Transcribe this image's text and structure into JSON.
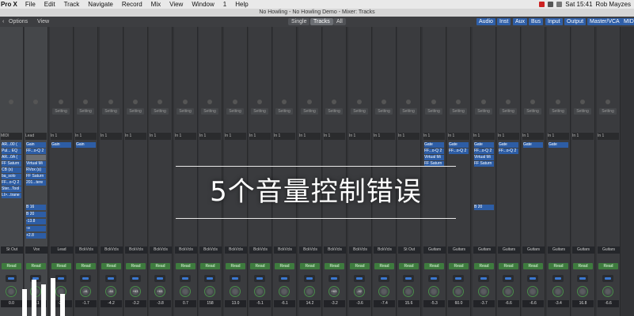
{
  "menubar": {
    "app_name": "Pro X",
    "items": [
      "File",
      "Edit",
      "Track",
      "Navigate",
      "Record",
      "Mix",
      "View",
      "Window",
      "1",
      "Help"
    ],
    "clock": "Sat 15:41",
    "user": "Rob Mayzes"
  },
  "window": {
    "title": "No Howling - No Howling Demo - Mixer: Tracks"
  },
  "toolbar": {
    "options_label": "Options",
    "view_label": "View",
    "view_modes": [
      "Single",
      "Tracks",
      "All"
    ],
    "active_view_mode": "Tracks",
    "filters": [
      "Audio",
      "Inst",
      "Aux",
      "Bus",
      "Input",
      "Output",
      "Master/VCA",
      "MIDI"
    ]
  },
  "overlay": {
    "caption": "5个音量控制错误"
  },
  "colors": {
    "accent_blue": "#2d5da5",
    "read_green": "#3e7b3e",
    "window_bg": "#2b2c2e",
    "strip_bg": "#3a3b3e"
  },
  "strips": [
    {
      "name": "St Out",
      "io": "MIDI",
      "setting": "",
      "plugins": [
        "AR...00 (",
        "Pul... EQ",
        "AR...0A (",
        "FF Saturn",
        "CB (s)",
        "ba_solo",
        "FF...o-Q 2",
        "Ster...Tool",
        "LI>...trane"
      ],
      "sends": [],
      "auto": "Read",
      "volume": "0.0",
      "knob": "",
      "sel": true
    },
    {
      "name": "Vox",
      "io": "Lead",
      "setting": "",
      "plugins": [
        "Gain",
        "FF...o-Q 2",
        "",
        "Virtual Mi",
        "RVox (s)",
        "FF Saturn",
        "201...tere"
      ],
      "sends": [
        "B 16",
        "B 20",
        "-13.8",
        "-∞",
        "+2.8"
      ],
      "auto": "Read",
      "volume": "-4.1",
      "knob": "",
      "sel": true
    },
    {
      "name": "Lead",
      "io": "In 1",
      "setting": "Setting",
      "plugins": [
        "Gain"
      ],
      "sends": [],
      "auto": "Read",
      "volume": "-2.9",
      "knob": "",
      "sel": false
    },
    {
      "name": "BckVcls",
      "io": "In 1",
      "setting": "Setting",
      "plugins": [
        "Gain"
      ],
      "sends": [],
      "auto": "Read",
      "volume": "-1.7",
      "knob": "-41",
      "sel": false
    },
    {
      "name": "BckVcls",
      "io": "In 1",
      "setting": "Setting",
      "plugins": [],
      "sends": [],
      "auto": "Read",
      "volume": "-4.2",
      "knob": "-64",
      "sel": false
    },
    {
      "name": "BckVcls",
      "io": "In 1",
      "setting": "Setting",
      "plugins": [],
      "sends": [],
      "auto": "Read",
      "volume": "-3.2",
      "knob": "+63",
      "sel": false
    },
    {
      "name": "BckVcls",
      "io": "In 1",
      "setting": "Setting",
      "plugins": [],
      "sends": [],
      "auto": "Read",
      "volume": "-3.8",
      "knob": "+63",
      "sel": false
    },
    {
      "name": "BckVcls",
      "io": "In 1",
      "setting": "Setting",
      "plugins": [],
      "sends": [],
      "auto": "Read",
      "volume": "0.7",
      "knob": "",
      "sel": false
    },
    {
      "name": "BckVcls",
      "io": "In 1",
      "setting": "Setting",
      "plugins": [],
      "sends": [],
      "auto": "Read",
      "volume": "158",
      "knob": "",
      "sel": false
    },
    {
      "name": "BckVcls",
      "io": "In 1",
      "setting": "Setting",
      "plugins": [],
      "sends": [],
      "auto": "Read",
      "volume": "13.0",
      "knob": "",
      "sel": false
    },
    {
      "name": "BckVcls",
      "io": "In 1",
      "setting": "Setting",
      "plugins": [],
      "sends": [],
      "auto": "Read",
      "volume": "-5.1",
      "knob": "",
      "sel": false
    },
    {
      "name": "BckVcls",
      "io": "In 1",
      "setting": "Setting",
      "plugins": [],
      "sends": [],
      "auto": "Read",
      "volume": "-6.1",
      "knob": "",
      "sel": false
    },
    {
      "name": "BckVcls",
      "io": "In 1",
      "setting": "Setting",
      "plugins": [],
      "sends": [],
      "auto": "Read",
      "volume": "14.2",
      "knob": "",
      "sel": false
    },
    {
      "name": "BckVcls",
      "io": "In 1",
      "setting": "Setting",
      "plugins": [],
      "sends": [],
      "auto": "Read",
      "volume": "-3.2",
      "knob": "+63",
      "sel": false
    },
    {
      "name": "BckVcls",
      "io": "In 1",
      "setting": "Setting",
      "plugins": [],
      "sends": [],
      "auto": "Read",
      "volume": "-3.6",
      "knob": "-42",
      "sel": false
    },
    {
      "name": "BckVcls",
      "io": "In 1",
      "setting": "Setting",
      "plugins": [],
      "sends": [],
      "auto": "Read",
      "volume": "-7.4",
      "knob": "",
      "sel": false
    },
    {
      "name": "St Out",
      "io": "In 1",
      "setting": "Setting",
      "plugins": [],
      "sends": [],
      "auto": "Read",
      "volume": "15.6",
      "knob": "",
      "sel": false
    },
    {
      "name": "Guitars",
      "io": "In 1",
      "setting": "Setting",
      "plugins": [
        "Gate",
        "FF...o-Q 2",
        "Virtual Mi",
        "FF Saturn"
      ],
      "sends": [],
      "auto": "Read",
      "volume": "-5.3",
      "knob": "",
      "sel": false
    },
    {
      "name": "Guitars",
      "io": "In 1",
      "setting": "Setting",
      "plugins": [
        "Gate",
        "FF...o-Q 2"
      ],
      "sends": [],
      "auto": "Read",
      "volume": "60.0",
      "knob": "",
      "sel": false
    },
    {
      "name": "Guitars",
      "io": "In 1",
      "setting": "Setting",
      "plugins": [
        "Gate",
        "FF...o-Q 2",
        "Virtual Mi",
        "FF Saturn"
      ],
      "sends": [
        "B 20"
      ],
      "auto": "Read",
      "volume": "-3.7",
      "knob": "",
      "sel": false
    },
    {
      "name": "Guitars",
      "io": "In 1",
      "setting": "Setting",
      "plugins": [
        "Gate",
        "FF...o-Q 2"
      ],
      "sends": [],
      "auto": "Read",
      "volume": "-6.6",
      "knob": "",
      "sel": false
    },
    {
      "name": "Guitars",
      "io": "In 1",
      "setting": "Setting",
      "plugins": [
        "Gate"
      ],
      "sends": [],
      "auto": "Read",
      "volume": "-6.6",
      "knob": "",
      "sel": false
    },
    {
      "name": "Guitars",
      "io": "In 1",
      "setting": "Setting",
      "plugins": [
        "Gate"
      ],
      "sends": [],
      "auto": "Read",
      "volume": "-3.4",
      "knob": "",
      "sel": false
    },
    {
      "name": "Guitars",
      "io": "In 1",
      "setting": "Setting",
      "plugins": [],
      "sends": [],
      "auto": "Read",
      "volume": "16.8",
      "knob": "",
      "sel": false
    },
    {
      "name": "Guitars",
      "io": "In 1",
      "setting": "Setting",
      "plugins": [],
      "sends": [],
      "auto": "Read",
      "volume": "-6.6",
      "knob": "",
      "sel": false
    }
  ]
}
